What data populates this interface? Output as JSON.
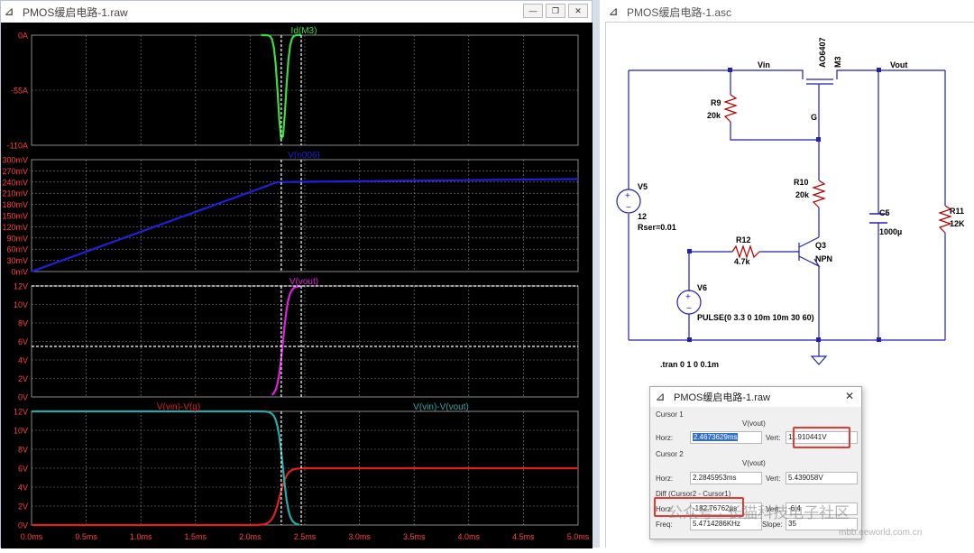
{
  "waveform_window": {
    "title": "PMOS缓启电路-1.raw",
    "min_label": "—",
    "restore_label": "❐",
    "close_label": "✕",
    "panes": [
      {
        "traces": [
          "Id(M3)"
        ],
        "trace_colors": [
          "#3ddc3d"
        ],
        "y_ticks": [
          "0A",
          "-55A",
          "-110A"
        ]
      },
      {
        "traces": [
          "V(n006)"
        ],
        "trace_colors": [
          "#2020d8"
        ],
        "y_ticks": [
          "300mV",
          "270mV",
          "240mV",
          "210mV",
          "180mV",
          "150mV",
          "120mV",
          "90mV",
          "60mV",
          "30mV",
          "0mV"
        ]
      },
      {
        "traces": [
          "V(vout)"
        ],
        "trace_colors": [
          "#e020e0"
        ],
        "y_ticks": [
          "12V",
          "10V",
          "8V",
          "6V",
          "4V",
          "2V",
          "0V"
        ]
      },
      {
        "traces": [
          "V(vin)-V(g)",
          "V(vin)-V(vout)"
        ],
        "trace_colors": [
          "#e02020",
          "#2aa8a8"
        ],
        "y_ticks": [
          "12V",
          "10V",
          "8V",
          "6V",
          "4V",
          "2V",
          "0V"
        ]
      }
    ],
    "x_ticks": [
      "0.0ms",
      "0.5ms",
      "1.0ms",
      "1.5ms",
      "2.0ms",
      "2.5ms",
      "3.0ms",
      "3.5ms",
      "4.0ms",
      "4.5ms",
      "5.0ms"
    ],
    "x_range_ms": [
      0,
      5
    ],
    "cursor1_ms": 2.4673629,
    "cursor2_ms": 2.2845953,
    "grid": true,
    "colors": {
      "background": "#000000",
      "grid": "#8a8a8a",
      "axis_text": "#ff4040",
      "cursor": "#ffffff"
    }
  },
  "schematic_window": {
    "title": "PMOS缓启电路-1.asc",
    "nets": {
      "vin": "Vin",
      "vout": "Vout",
      "gate": "G"
    },
    "m3": {
      "name": "M3",
      "model": "AO6407"
    },
    "r9": {
      "name": "R9",
      "value": "20k"
    },
    "r10": {
      "name": "R10",
      "value": "20k"
    },
    "r11": {
      "name": "R11",
      "value": "12K"
    },
    "r12": {
      "name": "R12",
      "value": "4.7k"
    },
    "c5": {
      "name": "C5",
      "value": "1000µ"
    },
    "q3": {
      "name": "Q3",
      "type": "NPN"
    },
    "v5": {
      "name": "V5",
      "value": "12",
      "rser": "Rser=0.01"
    },
    "v6": {
      "name": "V6",
      "pulse": "PULSE(0 3.3 0 10m 10m 30 60)"
    },
    "directive": ".tran 0 1 0 0.1m",
    "colors": {
      "wire": "#2222aa",
      "component": "#b00000",
      "text": "#000000",
      "dot": "#2222aa"
    }
  },
  "cursor_dialog": {
    "title": "PMOS缓启电路-1.raw",
    "close_label": "✕",
    "cursor1": {
      "label": "Cursor 1",
      "trace": "V(vout)",
      "horz_label": "Horz:",
      "horz": "2.4673629ms",
      "vert_label": "Vert:",
      "vert": "11.910441V"
    },
    "cursor2": {
      "label": "Cursor 2",
      "trace": "V(vout)",
      "horz_label": "Horz:",
      "horz": "2.2845953ms",
      "vert_label": "Vert:",
      "vert": "5.439058V"
    },
    "diff": {
      "label": "Diff (Cursor2 - Cursor1)",
      "horz_label": "Horz:",
      "horz": "-182.76762µs",
      "vert_label": "Vert:",
      "vert": "-6.4",
      "freq_label": "Freq:",
      "freq": "5.4714286KHz",
      "slope_label": "Slope:",
      "slope": "35"
    }
  },
  "watermark": {
    "text": "公众号 · 长猫科技电子社区",
    "domain": "mbb.eeworld.com.cn"
  }
}
